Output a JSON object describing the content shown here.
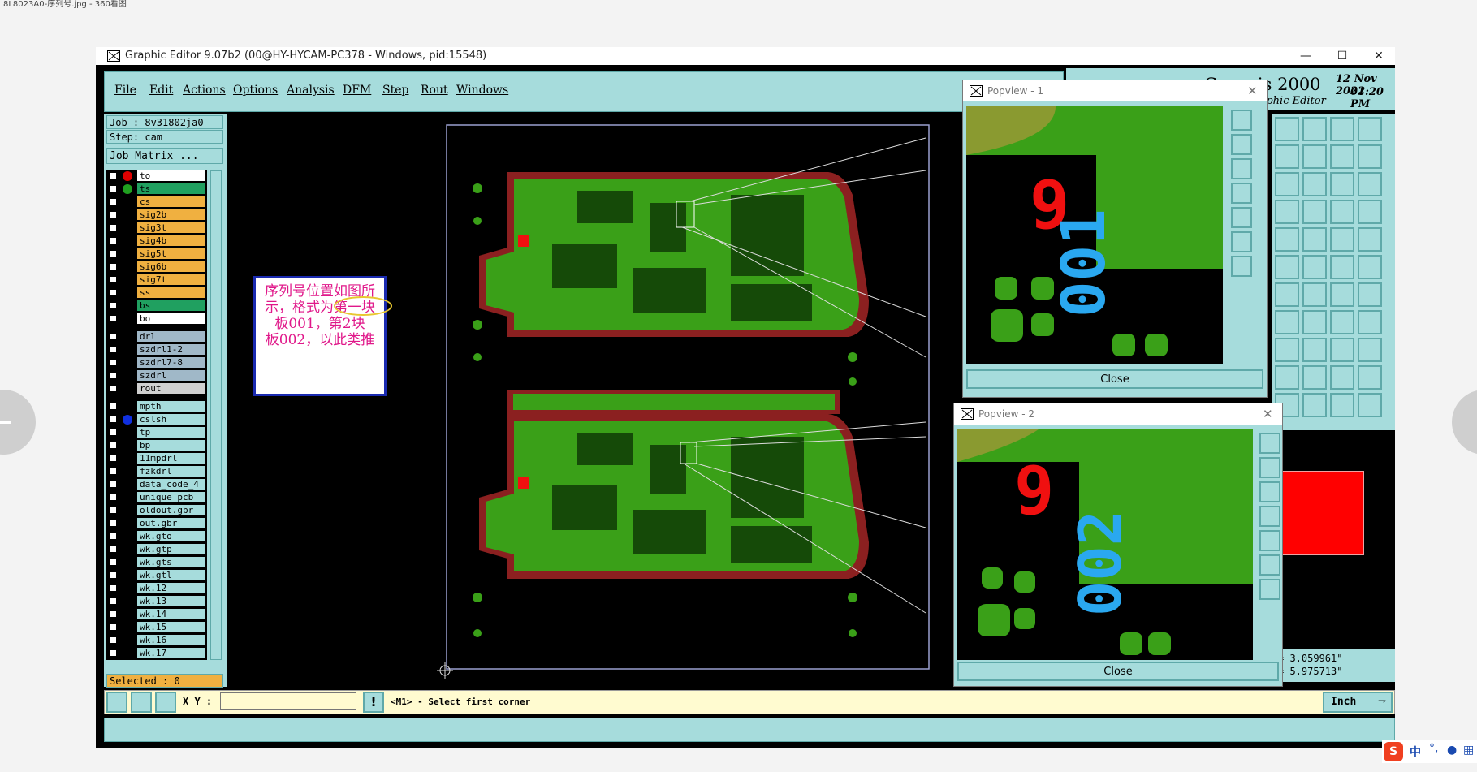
{
  "viewer": {
    "title": "8L8023A0-序列号.jpg - 360看图"
  },
  "window": {
    "title": "Graphic Editor 9.07b2 (00@HY-HYCAM-PC378 - Windows, pid:15548)",
    "min_label": "—",
    "max_label": "☐",
    "close_label": "✕"
  },
  "menu": {
    "items": [
      "File",
      "Edit",
      "Actions",
      "Options",
      "Analysis",
      "DFM",
      "Step",
      "Rout",
      "Windows"
    ]
  },
  "genesis": {
    "brand": "Genesis 2000",
    "date": "12 Nov 2022",
    "time": "01:20 PM",
    "subtitle": "Graphic Editor"
  },
  "left_panel": {
    "job": "Job : 8v31802ja0",
    "step": "Step: cam",
    "matrix_button": "Job Matrix ...",
    "selected": "Selected : 0",
    "layers": [
      {
        "name": "to",
        "color": "#ffffff",
        "dot": "#e00000"
      },
      {
        "name": "ts",
        "color": "#20a060",
        "dot": "#20a020"
      },
      {
        "name": "cs",
        "color": "#f0b040",
        "dot": ""
      },
      {
        "name": "sig2b",
        "color": "#f0b040",
        "dot": ""
      },
      {
        "name": "sig3t",
        "color": "#f0b040",
        "dot": ""
      },
      {
        "name": "sig4b",
        "color": "#f0b040",
        "dot": ""
      },
      {
        "name": "sig5t",
        "color": "#f0b040",
        "dot": ""
      },
      {
        "name": "sig6b",
        "color": "#f0b040",
        "dot": ""
      },
      {
        "name": "sig7t",
        "color": "#f0b040",
        "dot": ""
      },
      {
        "name": "ss",
        "color": "#f0b040",
        "dot": ""
      },
      {
        "name": "bs",
        "color": "#20a060",
        "dot": ""
      },
      {
        "name": "bo",
        "color": "#ffffff",
        "dot": ""
      },
      {
        "name": "drl",
        "color": "#a0b8c8",
        "dot": ""
      },
      {
        "name": "szdrl1-2",
        "color": "#a0b8c8",
        "dot": ""
      },
      {
        "name": "szdrl7-8",
        "color": "#a0b8c8",
        "dot": ""
      },
      {
        "name": "szdrl",
        "color": "#a0b8c8",
        "dot": ""
      },
      {
        "name": "rout",
        "color": "#d0d0d0",
        "dot": ""
      },
      {
        "name": "mpth",
        "color": "#a6dcdc",
        "dot": ""
      },
      {
        "name": "cslsh",
        "color": "#a6dcdc",
        "dot": "#1030e0"
      },
      {
        "name": "tp",
        "color": "#a6dcdc",
        "dot": ""
      },
      {
        "name": "bp",
        "color": "#a6dcdc",
        "dot": ""
      },
      {
        "name": "11mpdrl",
        "color": "#a6dcdc",
        "dot": ""
      },
      {
        "name": "fzkdrl",
        "color": "#a6dcdc",
        "dot": ""
      },
      {
        "name": "data_code_4",
        "color": "#a6dcdc",
        "dot": ""
      },
      {
        "name": "unique_pcb",
        "color": "#a6dcdc",
        "dot": ""
      },
      {
        "name": "oldout.gbr",
        "color": "#a6dcdc",
        "dot": ""
      },
      {
        "name": "out.gbr",
        "color": "#a6dcdc",
        "dot": ""
      },
      {
        "name": "wk.gto",
        "color": "#a6dcdc",
        "dot": ""
      },
      {
        "name": "wk.gtp",
        "color": "#a6dcdc",
        "dot": ""
      },
      {
        "name": "wk.gts",
        "color": "#a6dcdc",
        "dot": ""
      },
      {
        "name": "wk.gtl",
        "color": "#a6dcdc",
        "dot": ""
      },
      {
        "name": "wk.12",
        "color": "#a6dcdc",
        "dot": ""
      },
      {
        "name": "wk.13",
        "color": "#a6dcdc",
        "dot": ""
      },
      {
        "name": "wk.14",
        "color": "#a6dcdc",
        "dot": ""
      },
      {
        "name": "wk.15",
        "color": "#a6dcdc",
        "dot": ""
      },
      {
        "name": "wk.16",
        "color": "#a6dcdc",
        "dot": ""
      },
      {
        "name": "wk.17",
        "color": "#a6dcdc",
        "dot": ""
      }
    ]
  },
  "annotation": {
    "line1": "序列号位置如图所",
    "line2": "示，格式为第一块",
    "line3": "板001，第2块",
    "line4": "板002，以此类推"
  },
  "popup1": {
    "title": "Popview - 1",
    "digit": "9",
    "serial": "001",
    "close_label": "Close"
  },
  "popup2": {
    "title": "Popview - 2",
    "digit": "9",
    "serial": "002",
    "close_label": "Close"
  },
  "coords": {
    "x": "= 3.059961\"",
    "y": "= 5.975713\""
  },
  "command": {
    "xy_label": "X Y :",
    "xy_value": "",
    "prompt": "<M1> - Select first corner",
    "units": "Inch"
  },
  "taskbar": {
    "ime_lang": "中"
  },
  "colors": {
    "cyan": "#a6dcdc",
    "pcb_green": "#3aa018",
    "pcb_copper": "#8b2020",
    "serial_red": "#f01010",
    "serial_blue": "#2aa8f0"
  }
}
